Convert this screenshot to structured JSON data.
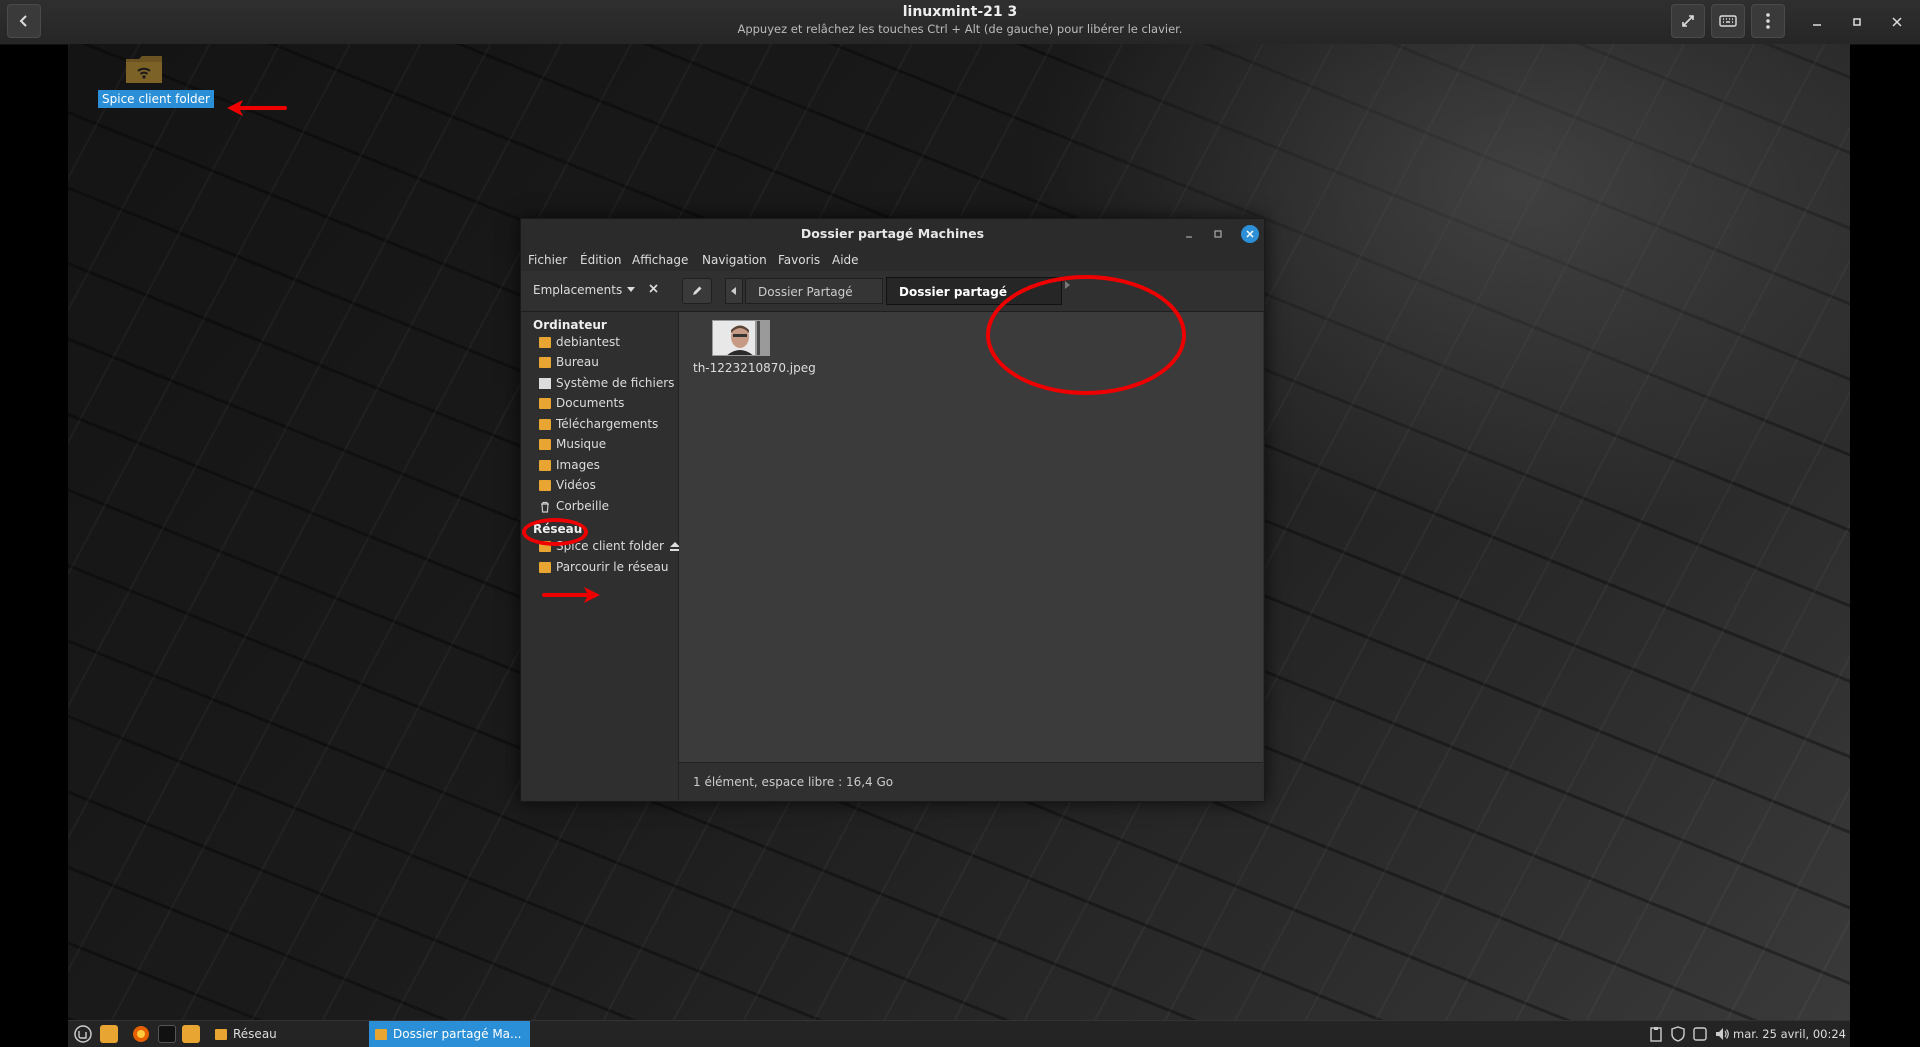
{
  "viewer": {
    "title": "linuxmint-21 3",
    "subtitle": "Appuyez et relâchez les touches Ctrl + Alt (de gauche) pour libérer le clavier."
  },
  "desktop": {
    "icon_label": "Spice client folder"
  },
  "window": {
    "title": "Dossier partagé Machines",
    "menu": [
      "Fichier",
      "Édition",
      "Affichage",
      "Navigation",
      "Favoris",
      "Aide"
    ],
    "places_label": "Emplacements",
    "breadcrumbs": [
      "Dossier Partagé Machines",
      "Dossier partagé Machines"
    ],
    "sidebar": {
      "computer_header": "Ordinateur",
      "computer_items": [
        {
          "label": "debiantest",
          "icon": "home-folder-icon"
        },
        {
          "label": "Bureau",
          "icon": "folder-icon"
        },
        {
          "label": "Système de fichiers",
          "icon": "drive-icon"
        },
        {
          "label": "Documents",
          "icon": "folder-icon"
        },
        {
          "label": "Téléchargements",
          "icon": "folder-icon"
        },
        {
          "label": "Musique",
          "icon": "folder-icon"
        },
        {
          "label": "Images",
          "icon": "folder-icon"
        },
        {
          "label": "Vidéos",
          "icon": "folder-icon"
        },
        {
          "label": "Corbeille",
          "icon": "trash-icon"
        }
      ],
      "network_header": "Réseau",
      "network_items": [
        {
          "label": "Spice client folder",
          "icon": "network-folder-icon"
        },
        {
          "label": "Parcourir le réseau",
          "icon": "network-icon"
        }
      ]
    },
    "files": [
      {
        "name": "th-1223210870.jpeg",
        "icon": "image-thumbnail"
      }
    ],
    "status": "1 élément, espace libre : 16,4 Go"
  },
  "taskbar": {
    "tasks": [
      "Réseau",
      "Dossier partagé Ma..."
    ],
    "clock": "mar. 25 avril, 00:24"
  },
  "colors": {
    "accent": "#2a8fd6",
    "folder": "#e9a531",
    "annotation": "#e00000"
  }
}
